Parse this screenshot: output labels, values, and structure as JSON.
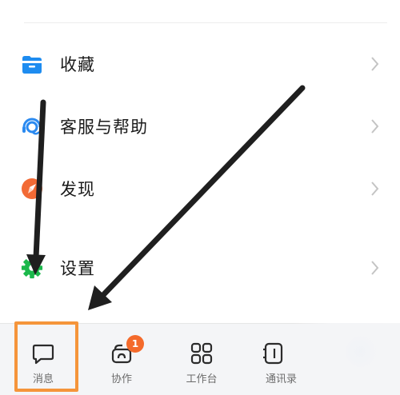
{
  "menu": {
    "items": [
      {
        "label": "收藏",
        "icon": "folder-icon"
      },
      {
        "label": "客服与帮助",
        "icon": "headset-icon"
      },
      {
        "label": "发现",
        "icon": "compass-icon"
      },
      {
        "label": "设置",
        "icon": "gear-icon"
      }
    ]
  },
  "tabbar": {
    "tabs": [
      {
        "label": "消息",
        "icon": "message-icon",
        "selected": true
      },
      {
        "label": "协作",
        "icon": "collab-icon",
        "badge": "1"
      },
      {
        "label": "工作台",
        "icon": "grid-icon"
      },
      {
        "label": "通讯录",
        "icon": "contacts-icon"
      }
    ]
  },
  "colors": {
    "highlight": "#f5953b",
    "badge": "#f46a2b",
    "folder_icon": "#1e8cf0",
    "help_icon": "#2b8af0",
    "discover_icon": "#f26a35",
    "settings_icon": "#1bb84b"
  }
}
